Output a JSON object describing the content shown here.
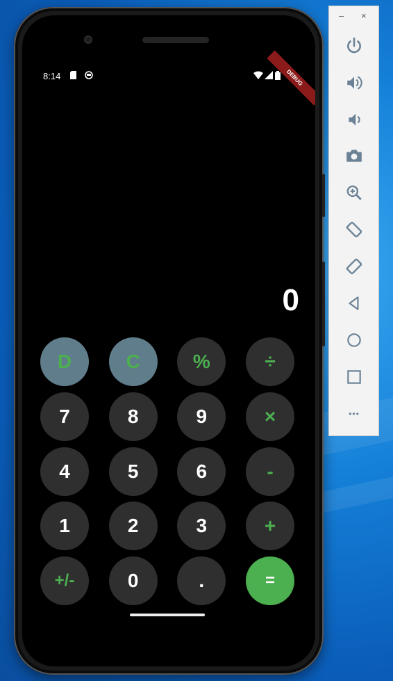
{
  "status_bar": {
    "time": "8:14",
    "debug_label": "DEBUG"
  },
  "display": {
    "value": "0"
  },
  "keypad": {
    "rows": [
      [
        "D",
        "C",
        "%",
        "÷"
      ],
      [
        "7",
        "8",
        "9",
        "×"
      ],
      [
        "4",
        "5",
        "6",
        "-"
      ],
      [
        "1",
        "2",
        "3",
        "+"
      ],
      [
        "+/-",
        "0",
        ".",
        "="
      ]
    ]
  },
  "toolbar": {
    "minimize": "–",
    "close": "×",
    "items": [
      "power",
      "volume-up",
      "volume-down",
      "screenshot",
      "zoom",
      "rotate-left",
      "rotate-right",
      "back",
      "home",
      "overview",
      "more"
    ],
    "more_label": "•••"
  },
  "colors": {
    "accent_green": "#4caf50",
    "key_dark": "#2f2f2f",
    "key_slate": "#607d8b",
    "toolbar_icon": "#6b8296"
  }
}
